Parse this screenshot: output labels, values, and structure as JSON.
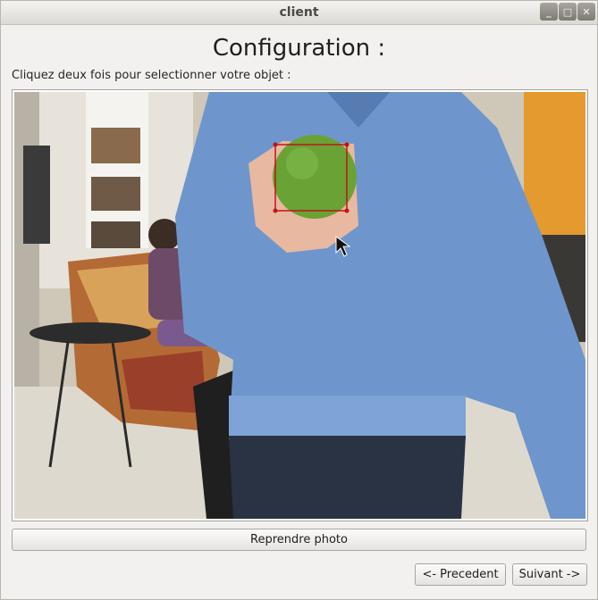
{
  "window": {
    "title": "client",
    "controls": [
      "_",
      "□",
      "✕"
    ]
  },
  "main": {
    "heading": "Configuration :",
    "instruction": "Cliquez deux fois pour selectionner votre objet :"
  },
  "buttons": {
    "retake": "Reprendre photo",
    "previous": "<- Precedent",
    "next": "Suivant ->"
  },
  "colors": {
    "selection": "#c0141a",
    "ball": "#6aa235",
    "sweater": "#6e96cc"
  }
}
